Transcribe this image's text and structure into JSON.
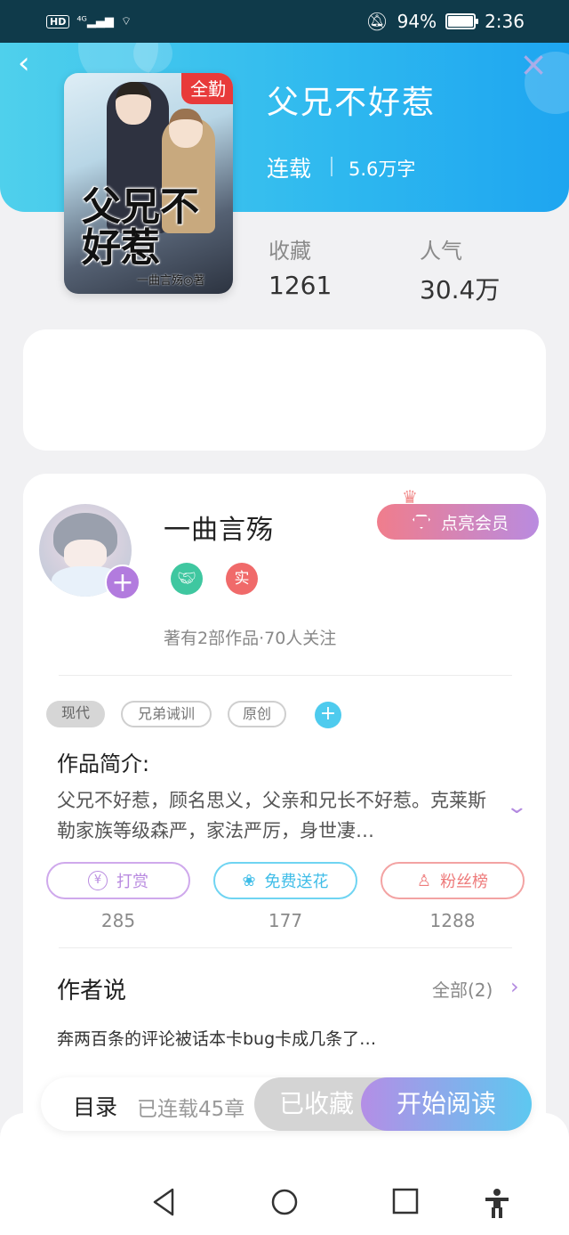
{
  "status_bar": {
    "left": "HD 4G",
    "battery": "94%",
    "time": "2:36"
  },
  "book": {
    "cover_tag": "全勤",
    "cover_title": "父兄不好惹",
    "cover_author": "一曲言殇◎著",
    "title": "父兄不好惹",
    "status": "连载",
    "words": "5.6万字",
    "stats": [
      {
        "label": "收藏",
        "value": "1261"
      },
      {
        "label": "人气",
        "value": "30.4万"
      }
    ]
  },
  "author": {
    "name": "一曲言殇",
    "vip_label": "点亮会员",
    "badge_real": "实",
    "meta": "著有2部作品·70人关注"
  },
  "tags": [
    "现代",
    "兄弟诫训",
    "原创"
  ],
  "intro": {
    "title": "作品简介:",
    "text": "父兄不好惹，顾名思义，父亲和兄长不好惹。克莱斯勒家族等级森严，家法严厉，身世凄…"
  },
  "actions": [
    {
      "label": "打赏",
      "count": "285",
      "color": "#b98be0"
    },
    {
      "label": "免费送花",
      "count": "177",
      "color": "#4ecbee"
    },
    {
      "label": "粉丝榜",
      "count": "1288",
      "color": "#f07d7d"
    }
  ],
  "author_says": {
    "title": "作者说",
    "all_label": "全部(2)",
    "text": "奔两百条的评论被话本卡bug卡成几条了…"
  },
  "bottom": {
    "toc_label": "目录",
    "toc_meta": "已连载45章",
    "collected_label": "已收藏",
    "read_label": "开始阅读"
  },
  "colors": {
    "banner": "#2eb8ef",
    "accent_purple": "#b27bde",
    "accent_pink": "#f07d8c"
  }
}
